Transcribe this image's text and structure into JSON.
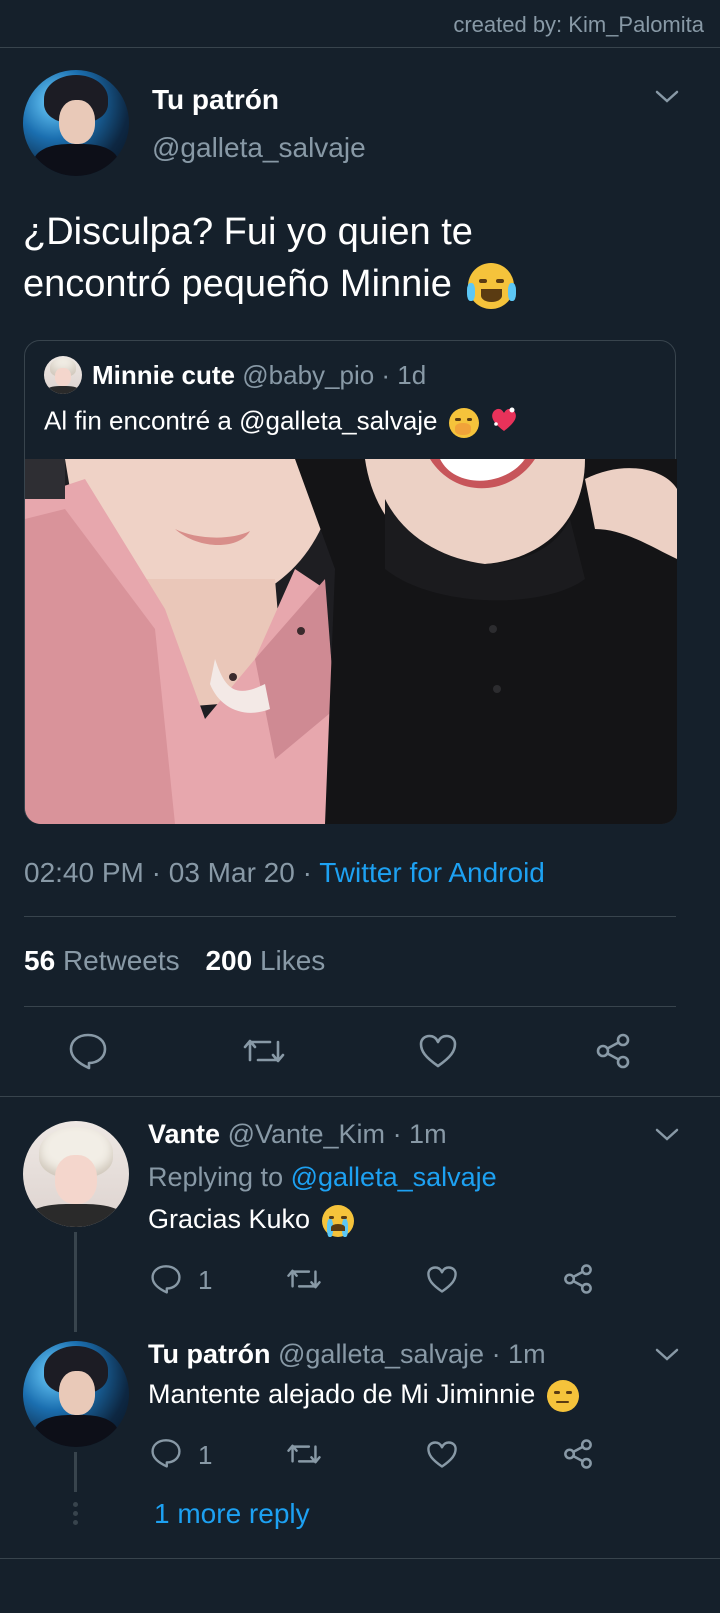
{
  "header": {
    "credit": "created by: Kim_Palomita"
  },
  "tweet": {
    "name": "Tu patrón",
    "handle": "@galleta_salvaje",
    "text_line1": "¿Disculpa? Fui yo quien te",
    "text_line2": "encontró pequeño Minnie",
    "quote": {
      "name": "Minnie cute",
      "handle": "@baby_pio",
      "time": "· 1d",
      "text": "Al fin encontré a @galleta_salvaje"
    },
    "time": "02:40 PM",
    "date": "· 03 Mar 20 ·",
    "source": "Twitter for Android",
    "retweets_count": "56",
    "retweets_label": "Retweets",
    "likes_count": "200",
    "likes_label": "Likes"
  },
  "replies": [
    {
      "name": "Vante",
      "handle": "@Vante_Kim",
      "time": "· 1m",
      "replying_prefix": "Replying to",
      "replying_to": "@galleta_salvaje",
      "text": "Gracias Kuko",
      "reply_count": "1"
    },
    {
      "name": "Tu patrón",
      "handle": "@galleta_salvaje",
      "time": "· 1m",
      "text": "Mantente alejado de Mi Jiminnie",
      "reply_count": "1"
    }
  ],
  "more_replies": "1 more reply",
  "colors": {
    "background": "#15202b",
    "accent": "#1da1f2",
    "muted": "#8899a6",
    "divider": "#38444d"
  },
  "icons": [
    "chevron-down-icon",
    "reply-icon",
    "retweet-icon",
    "like-icon",
    "share-icon"
  ]
}
